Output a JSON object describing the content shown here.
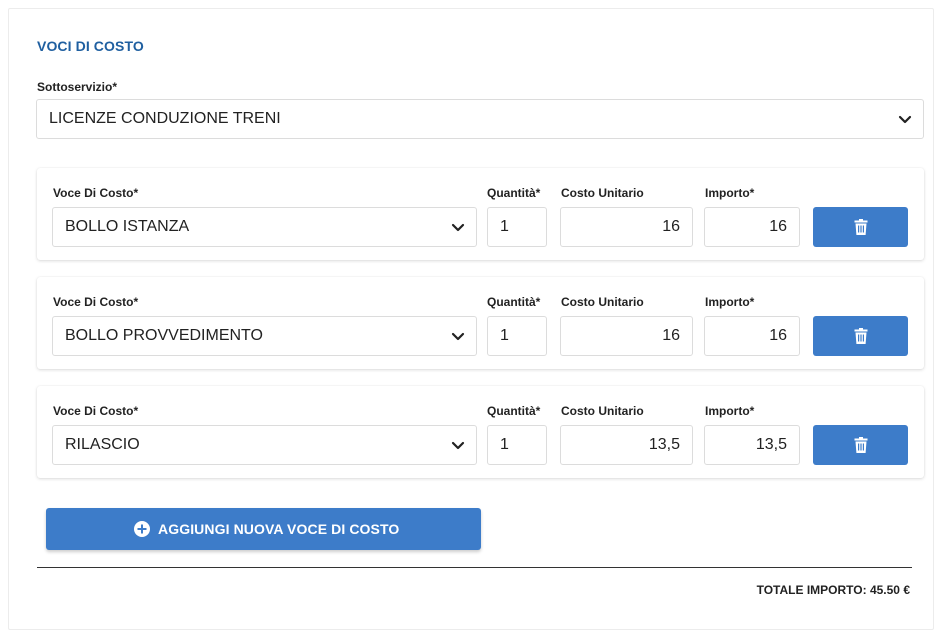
{
  "section": {
    "title": "VOCI DI COSTO"
  },
  "sottoservizio": {
    "label": "Sottoservizio",
    "required_mark": "*",
    "value": "LICENZE CONDUZIONE TRENI"
  },
  "rows": [
    {
      "voce_label": "Voce Di Costo*",
      "voce_value": "BOLLO ISTANZA",
      "quantita_label": "Quantità*",
      "quantita_value": "1",
      "costo_label": "Costo Unitario",
      "costo_value": "16",
      "importo_label": "Importo*",
      "importo_value": "16"
    },
    {
      "voce_label": "Voce Di Costo*",
      "voce_value": "BOLLO PROVVEDIMENTO",
      "quantita_label": "Quantità*",
      "quantita_value": "1",
      "costo_label": "Costo Unitario",
      "costo_value": "16",
      "importo_label": "Importo*",
      "importo_value": "16"
    },
    {
      "voce_label": "Voce Di Costo*",
      "voce_value": "RILASCIO",
      "quantita_label": "Quantità*",
      "quantita_value": "1",
      "costo_label": "Costo Unitario",
      "costo_value": "13,5",
      "importo_label": "Importo*",
      "importo_value": "13,5"
    }
  ],
  "add_button": {
    "label": "AGGIUNGI NUOVA VOCE DI COSTO",
    "icon": "plus-circle-icon"
  },
  "delete_button": {
    "icon": "trash-icon"
  },
  "totale": {
    "label": "TOTALE IMPORTO:",
    "value": "45.50 €"
  },
  "colors": {
    "accent": "#3d7cc9",
    "title": "#1f5fa0"
  }
}
